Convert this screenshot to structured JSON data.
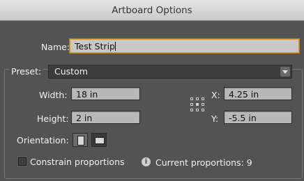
{
  "window": {
    "title": "Artboard Options"
  },
  "name": {
    "label": "Name:",
    "value": "Test Strip"
  },
  "preset": {
    "label": "Preset:",
    "value": "Custom"
  },
  "width": {
    "label": "Width:",
    "value": "18 in"
  },
  "height": {
    "label": "Height:",
    "value": "2 in"
  },
  "x": {
    "label": "X:",
    "value": "4.25 in"
  },
  "y": {
    "label": "Y:",
    "value": "-5.5 in"
  },
  "orientation": {
    "label": "Orientation:",
    "selected": "landscape"
  },
  "constrain": {
    "label": "Constrain proportions",
    "checked": false
  },
  "proportions": {
    "text": "Current proportions: 9"
  },
  "icons": [
    "reference-point-grid-icon",
    "portrait-icon",
    "landscape-icon",
    "info-icon",
    "dropdown-arrow-icon"
  ]
}
